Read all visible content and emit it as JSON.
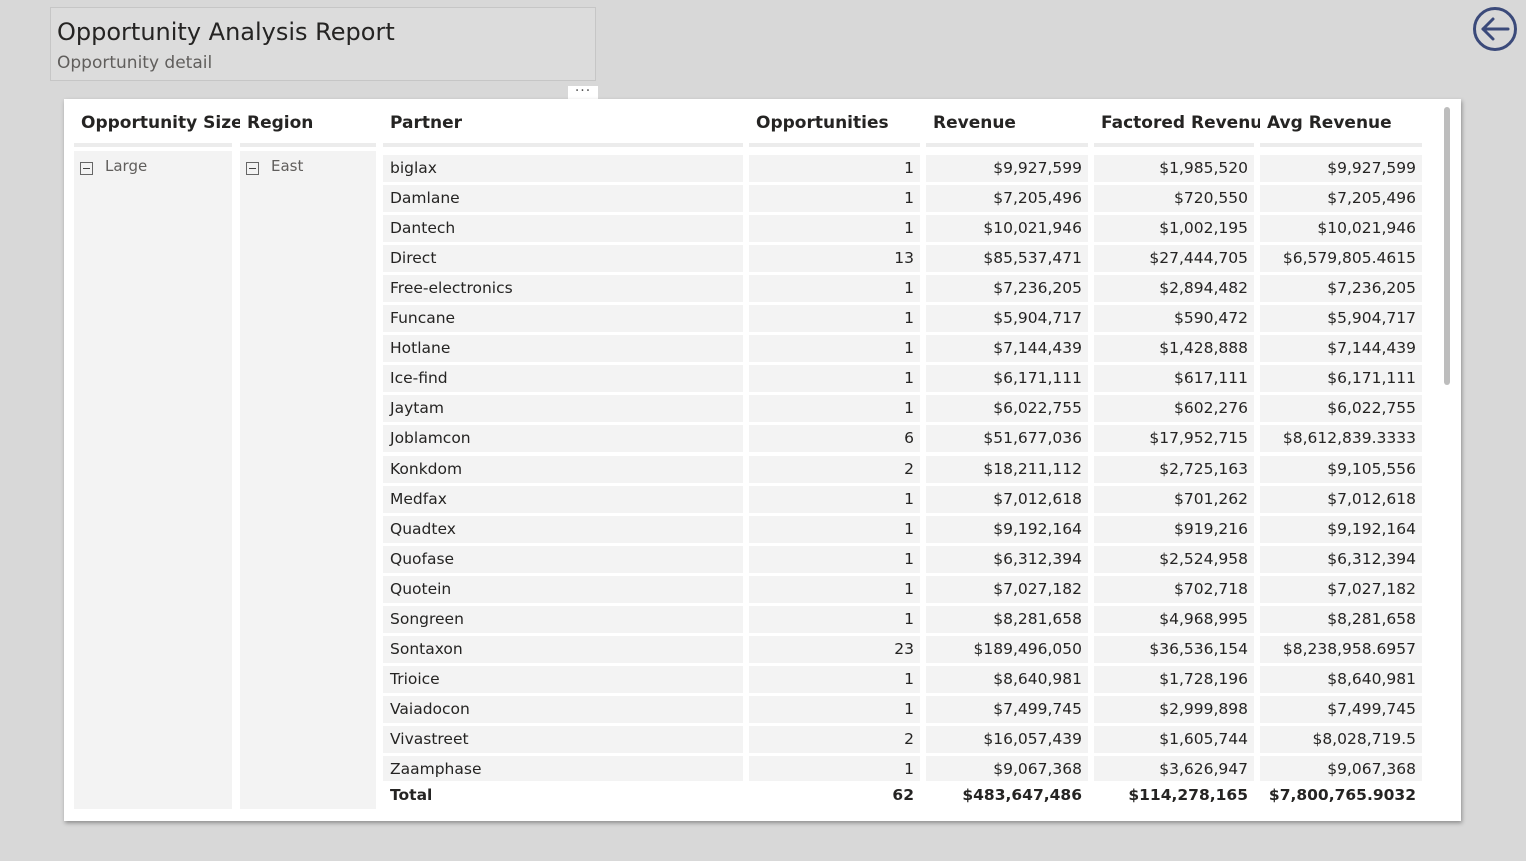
{
  "report": {
    "title": "Opportunity Analysis Report",
    "subtitle": "Opportunity detail"
  },
  "icons": {
    "back": "back-arrow-icon",
    "more": "more-options-icon",
    "more_glyph": "···",
    "collapse": "collapse-icon"
  },
  "colors": {
    "background": "#d8d8d8",
    "accent": "#3b4a7a",
    "row_band": "#f3f3f3"
  },
  "table": {
    "columns": [
      "Opportunity Size",
      "Region",
      "Partner",
      "Opportunities",
      "Revenue",
      "Factored Revenue",
      "Avg Revenue"
    ],
    "group": {
      "size": "Large",
      "region": "East"
    },
    "rows": [
      [
        "biglax",
        "1",
        "$9,927,599",
        "$1,985,520",
        "$9,927,599"
      ],
      [
        "Damlane",
        "1",
        "$7,205,496",
        "$720,550",
        "$7,205,496"
      ],
      [
        "Dantech",
        "1",
        "$10,021,946",
        "$1,002,195",
        "$10,021,946"
      ],
      [
        "Direct",
        "13",
        "$85,537,471",
        "$27,444,705",
        "$6,579,805.4615"
      ],
      [
        "Free-electronics",
        "1",
        "$7,236,205",
        "$2,894,482",
        "$7,236,205"
      ],
      [
        "Funcane",
        "1",
        "$5,904,717",
        "$590,472",
        "$5,904,717"
      ],
      [
        "Hotlane",
        "1",
        "$7,144,439",
        "$1,428,888",
        "$7,144,439"
      ],
      [
        "Ice-find",
        "1",
        "$6,171,111",
        "$617,111",
        "$6,171,111"
      ],
      [
        "Jaytam",
        "1",
        "$6,022,755",
        "$602,276",
        "$6,022,755"
      ],
      [
        "Joblamcon",
        "6",
        "$51,677,036",
        "$17,952,715",
        "$8,612,839.3333"
      ],
      [
        "Konkdom",
        "2",
        "$18,211,112",
        "$2,725,163",
        "$9,105,556"
      ],
      [
        "Medfax",
        "1",
        "$7,012,618",
        "$701,262",
        "$7,012,618"
      ],
      [
        "Quadtex",
        "1",
        "$9,192,164",
        "$919,216",
        "$9,192,164"
      ],
      [
        "Quofase",
        "1",
        "$6,312,394",
        "$2,524,958",
        "$6,312,394"
      ],
      [
        "Quotein",
        "1",
        "$7,027,182",
        "$702,718",
        "$7,027,182"
      ],
      [
        "Songreen",
        "1",
        "$8,281,658",
        "$4,968,995",
        "$8,281,658"
      ],
      [
        "Sontaxon",
        "23",
        "$189,496,050",
        "$36,536,154",
        "$8,238,958.6957"
      ],
      [
        "Trioice",
        "1",
        "$8,640,981",
        "$1,728,196",
        "$8,640,981"
      ],
      [
        "Vaiadocon",
        "1",
        "$7,499,745",
        "$2,999,898",
        "$7,499,745"
      ],
      [
        "Vivastreet",
        "2",
        "$16,057,439",
        "$1,605,744",
        "$8,028,719.5"
      ],
      [
        "Zaamphase",
        "1",
        "$9,067,368",
        "$3,626,947",
        "$9,067,368"
      ]
    ],
    "total": [
      "Total",
      "62",
      "$483,647,486",
      "$114,278,165",
      "$7,800,765.9032"
    ]
  }
}
